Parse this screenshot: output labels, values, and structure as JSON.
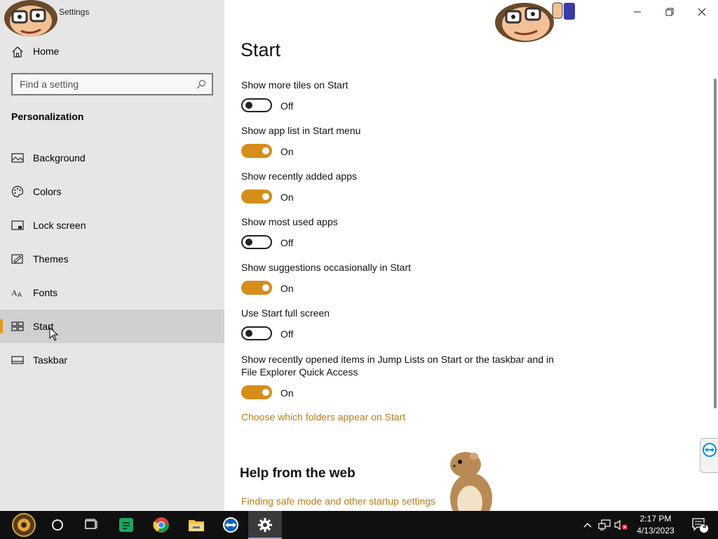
{
  "window": {
    "title": "Settings"
  },
  "sidebar": {
    "home_label": "Home",
    "search_placeholder": "Find a setting",
    "section_title": "Personalization",
    "items": [
      {
        "label": "Background",
        "icon": "picture-icon"
      },
      {
        "label": "Colors",
        "icon": "palette-icon"
      },
      {
        "label": "Lock screen",
        "icon": "lock-screen-icon"
      },
      {
        "label": "Themes",
        "icon": "themes-icon"
      },
      {
        "label": "Fonts",
        "icon": "fonts-icon"
      },
      {
        "label": "Start",
        "icon": "start-tiles-icon",
        "selected": true
      },
      {
        "label": "Taskbar",
        "icon": "taskbar-icon"
      }
    ]
  },
  "main": {
    "page_title": "Start",
    "settings": [
      {
        "label": "Show more tiles on Start",
        "state": "Off",
        "on": false
      },
      {
        "label": "Show app list in Start menu",
        "state": "On",
        "on": true
      },
      {
        "label": "Show recently added apps",
        "state": "On",
        "on": true
      },
      {
        "label": "Show most used apps",
        "state": "Off",
        "on": false
      },
      {
        "label": "Show suggestions occasionally in Start",
        "state": "On",
        "on": true
      },
      {
        "label": "Use Start full screen",
        "state": "Off",
        "on": false
      },
      {
        "label": "Show recently opened items in Jump Lists on Start or the taskbar and in File Explorer Quick Access",
        "state": "On",
        "on": true
      }
    ],
    "folders_link": "Choose which folders appear on Start",
    "help_title": "Help from the web",
    "help_link": "Finding safe mode and other startup settings"
  },
  "taskbar": {
    "apps": [
      "start-button",
      "search-circle-icon",
      "task-view-icon",
      "sheets-icon",
      "chrome-icon",
      "file-explorer-icon",
      "teamviewer-icon",
      "settings-gear-icon"
    ],
    "time": "2:17 PM",
    "date": "4/13/2023",
    "notification_count": "3"
  },
  "colors": {
    "accent": "#d68d1a",
    "link": "#b87d14",
    "sidebar_bg": "#e6e6e6",
    "taskbar_bg": "#101010"
  }
}
